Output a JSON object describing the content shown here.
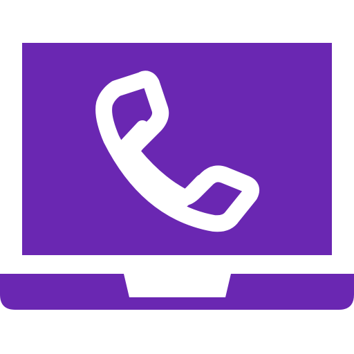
{
  "icon": {
    "name": "laptop-phone-call-icon",
    "parts": [
      "laptop-screen",
      "laptop-base",
      "phone-handset"
    ]
  },
  "colors": {
    "background": "#ffffff",
    "primary": "#6a27b2",
    "glyph": "#ffffff"
  }
}
